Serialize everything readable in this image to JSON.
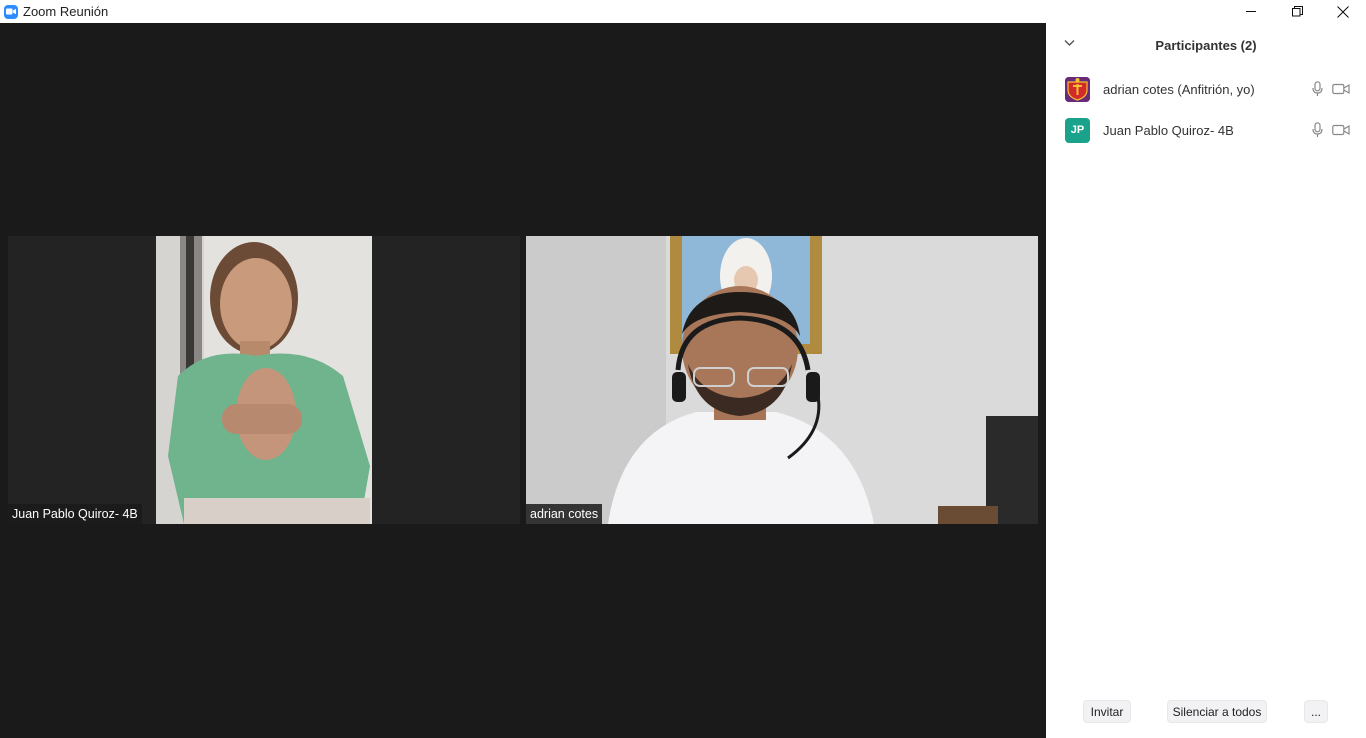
{
  "window": {
    "title": "Zoom Reunión",
    "icon": "zoom-camera-icon",
    "controls": [
      "minimize-icon",
      "restore-icon",
      "close-icon"
    ]
  },
  "video": {
    "tiles": [
      {
        "name": "Juan Pablo Quiroz- 4B"
      },
      {
        "name": "adrian cotes"
      }
    ]
  },
  "participants_panel": {
    "title": "Participantes (2)",
    "participants": [
      {
        "name": "adrian cotes (Anfitrión, yo)",
        "avatar": "crest-logo",
        "mic_icon": "microphone-icon",
        "cam_icon": "video-camera-icon"
      },
      {
        "name": "Juan Pablo Quiroz- 4B",
        "initials": "JP",
        "avatar_color": "#1aa38a",
        "mic_icon": "microphone-icon",
        "cam_icon": "video-camera-icon"
      }
    ],
    "footer": {
      "invite": "Invitar",
      "mute_all": "Silenciar a todos",
      "more": "..."
    }
  },
  "colors": {
    "video_bg": "#1a1a1a",
    "tile_bg": "#232323",
    "accent": "#2d8cff"
  }
}
